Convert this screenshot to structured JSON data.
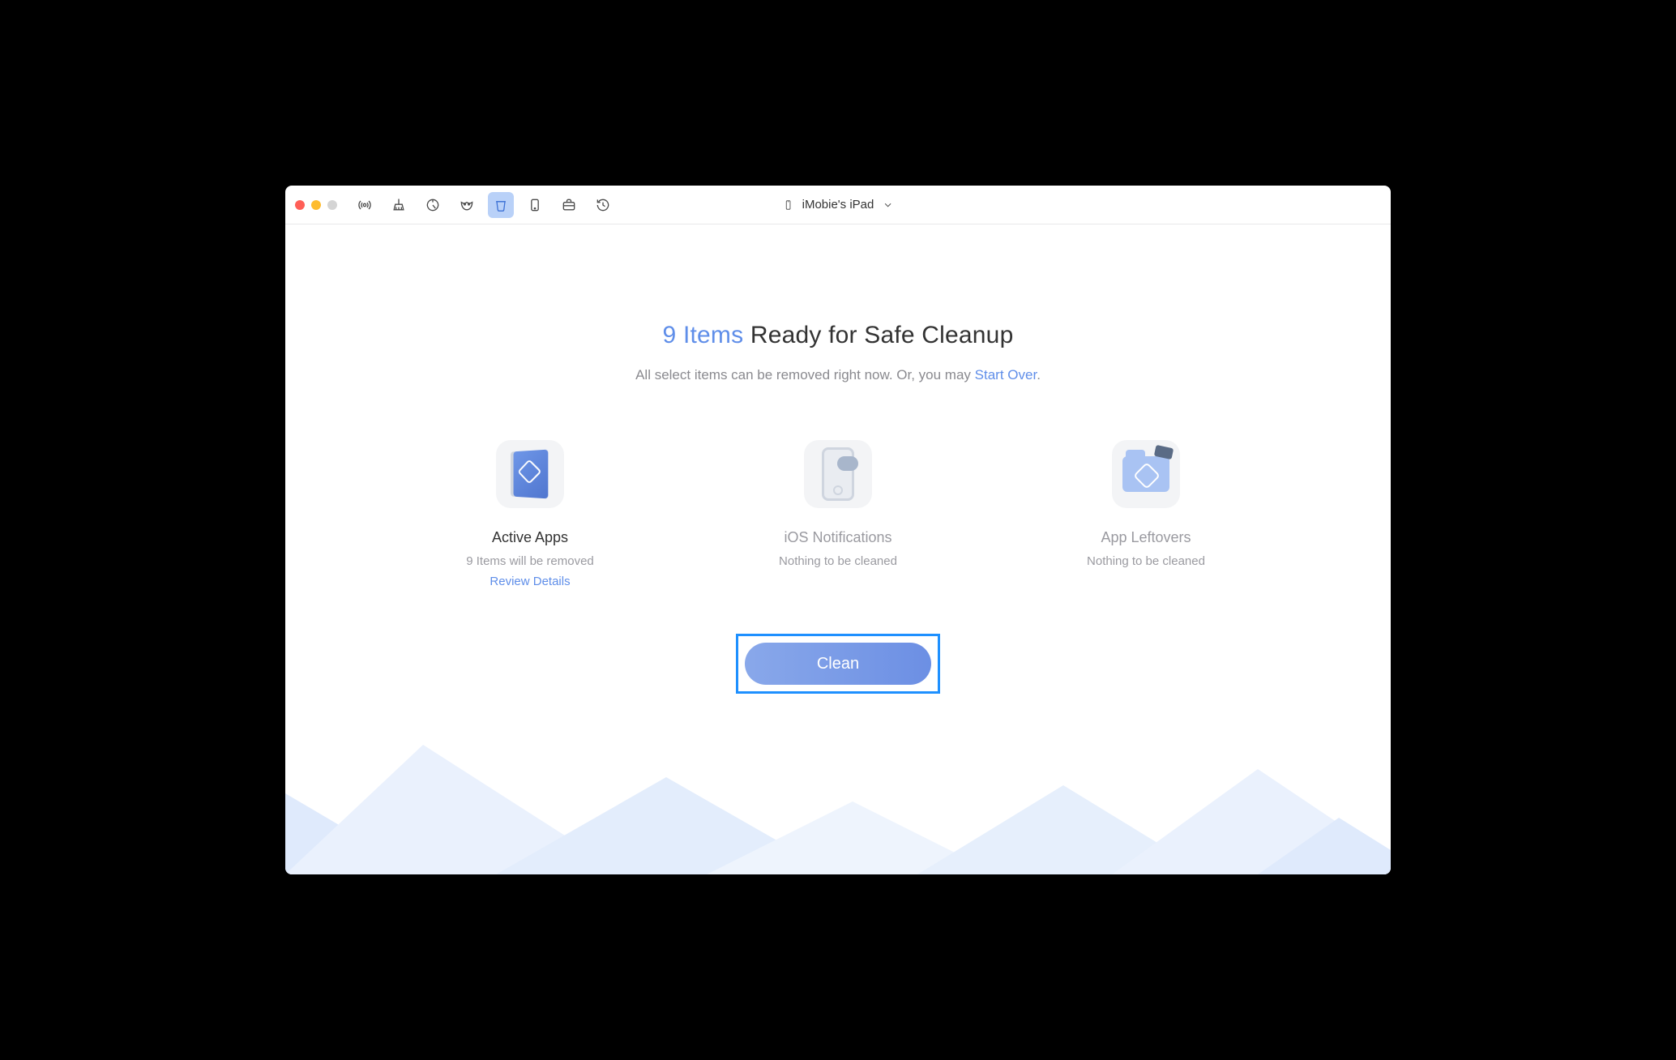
{
  "device": {
    "name": "iMobie's iPad"
  },
  "toolbar": {
    "icons": [
      "antenna",
      "broom",
      "circle-slash",
      "mask",
      "trash",
      "tablet",
      "briefcase",
      "clock"
    ],
    "active_index": 4
  },
  "headline": {
    "count_text": "9 Items",
    "rest": " Ready for Safe Cleanup"
  },
  "subhead": {
    "text": "All select items can be removed right now. Or, you may ",
    "link": "Start Over",
    "tail": "."
  },
  "cards": [
    {
      "key": "active-apps",
      "title": "Active Apps",
      "subtitle": "9 Items will be removed",
      "link": "Review Details",
      "muted": false
    },
    {
      "key": "ios-notifications",
      "title": "iOS Notifications",
      "subtitle": "Nothing to be cleaned",
      "link": "",
      "muted": true
    },
    {
      "key": "app-leftovers",
      "title": "App Leftovers",
      "subtitle": "Nothing to be cleaned",
      "link": "",
      "muted": true
    }
  ],
  "cta": {
    "label": "Clean"
  }
}
